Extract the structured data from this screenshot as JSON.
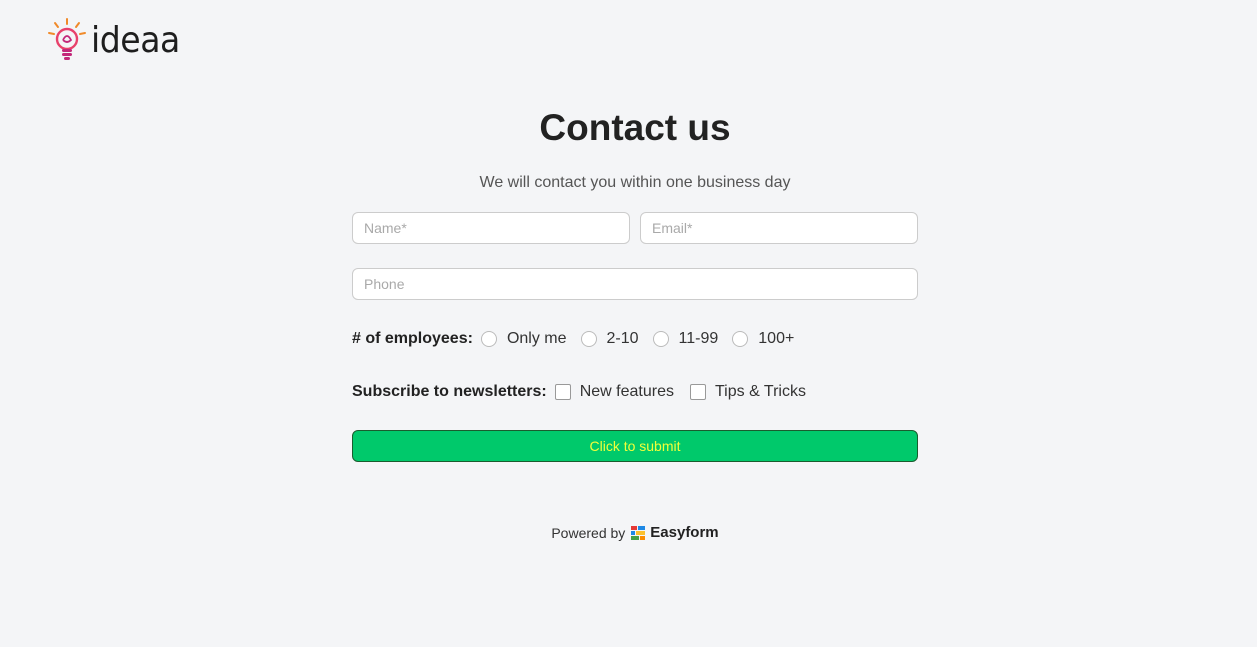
{
  "logo": {
    "text": "ideaa",
    "icon": "lightbulb-icon"
  },
  "form": {
    "title": "Contact us",
    "subtitle": "We will contact you within one business day",
    "name_placeholder": "Name*",
    "email_placeholder": "Email*",
    "phone_placeholder": "Phone",
    "employees": {
      "label": "# of employees:",
      "options": [
        "Only me",
        "2-10",
        "11-99",
        "100+"
      ]
    },
    "newsletters": {
      "label": "Subscribe to newsletters:",
      "options": [
        "New features",
        "Tips & Tricks"
      ]
    },
    "submit_label": "Click to submit"
  },
  "footer": {
    "powered_by": "Powered by",
    "brand": "Easyform",
    "brand_icon": "easyform-icon"
  },
  "colors": {
    "submit_bg": "#00c96b",
    "submit_text": "#f0ff3a",
    "background": "#f4f5f7"
  }
}
